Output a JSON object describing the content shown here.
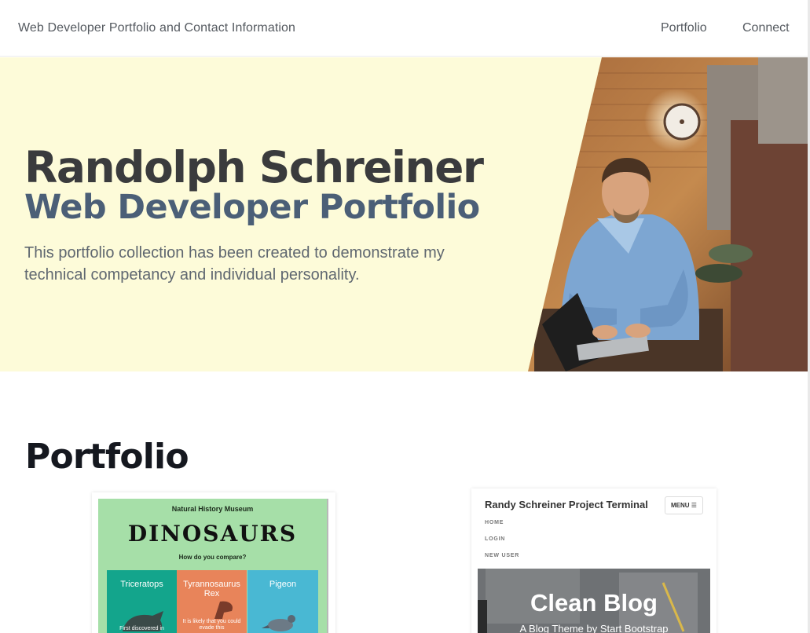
{
  "navbar": {
    "brand": "Web Developer Portfolio and Contact Information",
    "links": [
      "Portfolio",
      "Connect"
    ]
  },
  "hero": {
    "name": "Randolph Schreiner",
    "subtitle": "Web Developer Portfolio",
    "description": "This portfolio collection has been created to demonstrate my technical competancy and individual personality."
  },
  "portfolio": {
    "title": "Portfolio",
    "projects": [
      {
        "museum": "Natural History Museum",
        "title": "DINOSAURS",
        "question": "How do you compare?",
        "columns": [
          {
            "label": "Triceratops",
            "text": "First discovered in"
          },
          {
            "label": "Tyrannosaurus Rex",
            "text": "It is likely that you could evade this"
          },
          {
            "label": "Pigeon",
            "text": ""
          }
        ]
      },
      {
        "header": "Randy Schreiner Project Terminal",
        "menu": "MENU ☰",
        "nav": [
          "HOME",
          "LOGIN",
          "NEW USER"
        ],
        "hero_title": "Clean Blog",
        "hero_subtitle": "A Blog Theme by Start Bootstrap"
      }
    ]
  },
  "colors": {
    "hero_background": "#fdfbd9",
    "name_text": "#3a3b3d",
    "subtitle_text": "#4b5f77",
    "triceratops_panel": "#13a58c",
    "trex_panel": "#e8845a",
    "pigeon_panel": "#49b8d3"
  }
}
